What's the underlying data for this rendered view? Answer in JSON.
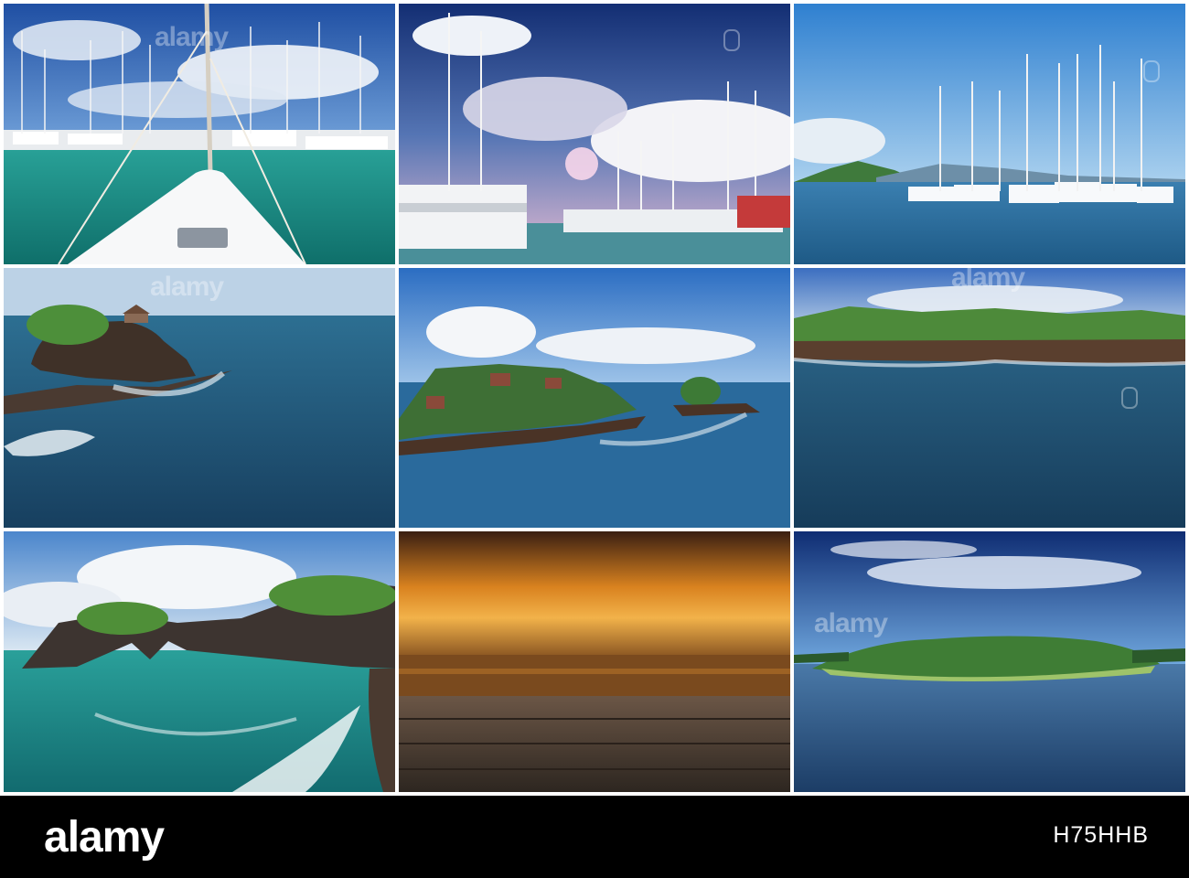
{
  "watermark_text": "alamy",
  "footer": {
    "logo": "alamy",
    "image_id": "H75HHB"
  },
  "photos": [
    {
      "subject": "Marina with yacht bow and masts, turquoise water",
      "sky": "#2e5bb0",
      "water": "#1d8f86"
    },
    {
      "subject": "Yacht marina under dramatic clouds with pink sunlight",
      "sky": "#1f3f8a",
      "water": "#3f8b92"
    },
    {
      "subject": "Row of sailboats moored in a calm blue bay",
      "sky": "#3b8ed6",
      "water": "#2e6f9c"
    },
    {
      "subject": "Rock islet with temple surrounded by ocean waves",
      "sky": "#a7c3df",
      "water": "#23607f"
    },
    {
      "subject": "Coastal temple complex on rocky shore, blue sky with clouds",
      "sky": "#3d7fce",
      "water": "#1f5f92"
    },
    {
      "subject": "Green rocky coastline over dark blue sea",
      "sky": "#4b80c8",
      "water": "#1d4f72"
    },
    {
      "subject": "Rock formation with natural arch and turquoise surf",
      "sky": "#5d93cf",
      "water": "#178c8c"
    },
    {
      "subject": "Orange sunset over the sea above a wooden plank foreground",
      "sky": "#d9821f",
      "water": "#7a3d12"
    },
    {
      "subject": "Green river island with trees under deep blue sky",
      "sky": "#1b4fa8",
      "water": "#2c5a8c"
    }
  ]
}
